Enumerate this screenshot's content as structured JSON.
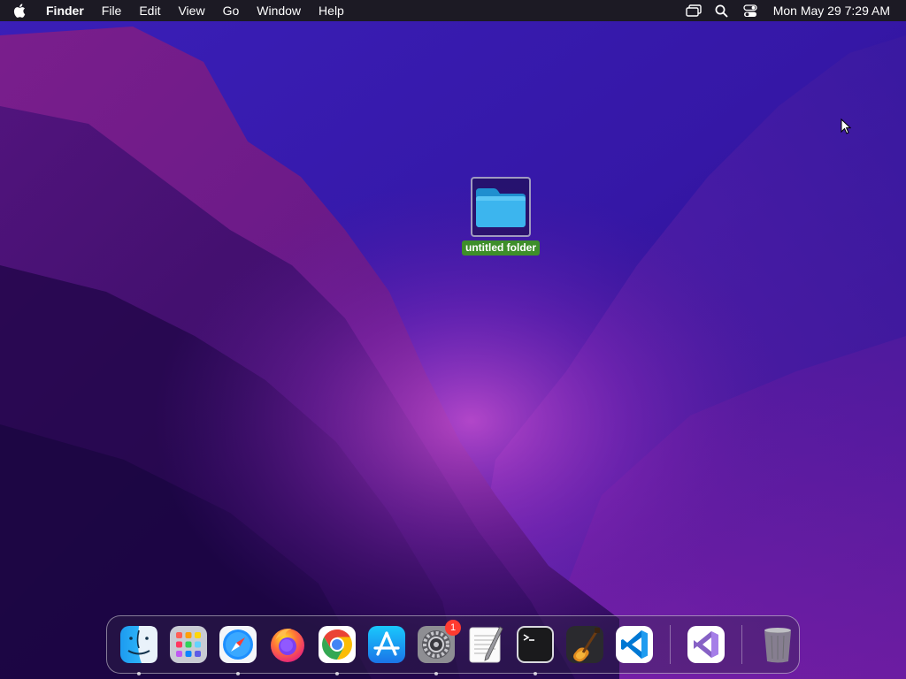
{
  "menubar": {
    "apple_menu_icon": "apple-logo-icon",
    "app_name": "Finder",
    "menus": [
      "File",
      "Edit",
      "View",
      "Go",
      "Window",
      "Help"
    ],
    "status_icons": [
      "screen-mirroring-icon",
      "spotlight-search-icon",
      "control-center-icon"
    ],
    "clock": "Mon May 29  7:29 AM"
  },
  "desktop": {
    "items": [
      {
        "label": "untitled folder",
        "icon": "folder-icon",
        "selected": true
      }
    ]
  },
  "dock": {
    "apps": [
      {
        "name": "Finder",
        "icon": "finder-icon",
        "running": true
      },
      {
        "name": "Launchpad",
        "icon": "launchpad-icon",
        "running": false
      },
      {
        "name": "Safari",
        "icon": "safari-icon",
        "running": true
      },
      {
        "name": "Firefox",
        "icon": "firefox-icon",
        "running": false
      },
      {
        "name": "Google Chrome",
        "icon": "chrome-icon",
        "running": true
      },
      {
        "name": "App Store",
        "icon": "app-store-icon",
        "running": false
      },
      {
        "name": "System Preferences",
        "icon": "system-preferences-icon",
        "running": true,
        "badge": "1"
      },
      {
        "name": "TextEdit",
        "icon": "textedit-icon",
        "running": false
      },
      {
        "name": "Terminal",
        "icon": "terminal-icon",
        "running": true
      },
      {
        "name": "GarageBand",
        "icon": "garageband-icon",
        "running": false
      },
      {
        "name": "Visual Studio Code",
        "icon": "vscode-icon",
        "running": false
      },
      {
        "name": "Visual Studio",
        "icon": "visual-studio-icon",
        "running": false
      },
      {
        "name": "Trash",
        "icon": "trash-icon",
        "running": false
      }
    ]
  },
  "colors": {
    "menubar_bg": "#1c1a24",
    "selection_label": "#3e8e2a",
    "folder_blue": "#1e9bd7",
    "badge_red": "#ff3b30"
  }
}
